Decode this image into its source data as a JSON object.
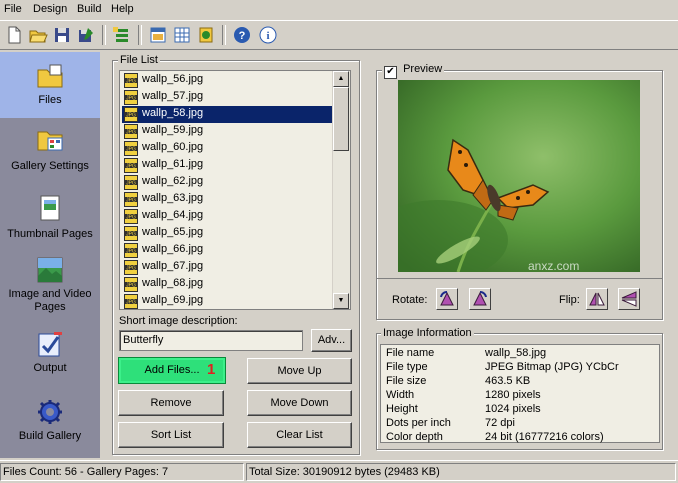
{
  "menu": [
    "File",
    "Design",
    "Build",
    "Help"
  ],
  "toolbar": {
    "icons": [
      "new-document-icon",
      "open-folder-icon",
      "save-icon",
      "save-as-icon",
      "add-files-icon",
      "html-page-icon",
      "table-layout-icon",
      "build-icon",
      "help-icon",
      "info-icon"
    ]
  },
  "nav": {
    "items": [
      {
        "label": "Files",
        "icon": "files-folder-icon"
      },
      {
        "label": "Gallery Settings",
        "icon": "gallery-settings-icon"
      },
      {
        "label": "Thumbnail Pages",
        "icon": "thumbnail-pages-icon"
      },
      {
        "label": "Image and Video Pages",
        "icon": "image-video-pages-icon"
      },
      {
        "label": "Output",
        "icon": "output-icon"
      },
      {
        "label": "Build Gallery",
        "icon": "build-gallery-icon"
      }
    ]
  },
  "file_list": {
    "title": "File List",
    "files": [
      "wallp_56.jpg",
      "wallp_57.jpg",
      "wallp_58.jpg",
      "wallp_59.jpg",
      "wallp_60.jpg",
      "wallp_61.jpg",
      "wallp_62.jpg",
      "wallp_63.jpg",
      "wallp_64.jpg",
      "wallp_65.jpg",
      "wallp_66.jpg",
      "wallp_67.jpg",
      "wallp_68.jpg",
      "wallp_69.jpg"
    ],
    "selected": "wallp_58.jpg",
    "icon_text": "JPG"
  },
  "description": {
    "label": "Short image description:",
    "value": "Butterfly",
    "adv_label": "Adv..."
  },
  "buttons": {
    "add_files": "Add Files...",
    "badge": "1",
    "move_up": "Move Up",
    "remove": "Remove",
    "move_down": "Move Down",
    "sort_list": "Sort List",
    "clear_list": "Clear List"
  },
  "preview": {
    "label": "Preview",
    "checked": true,
    "rotate_label": "Rotate:",
    "flip_label": "Flip:",
    "watermark": "anxz.com"
  },
  "image_info": {
    "title": "Image Information",
    "rows": [
      {
        "k": "File name",
        "v": "wallp_58.jpg"
      },
      {
        "k": "File type",
        "v": "JPEG Bitmap (JPG) YCbCr"
      },
      {
        "k": "File size",
        "v": "463.5 KB"
      },
      {
        "k": "Width",
        "v": "1280 pixels"
      },
      {
        "k": "Height",
        "v": "1024 pixels"
      },
      {
        "k": "Dots per inch",
        "v": "72 dpi"
      },
      {
        "k": "Color depth",
        "v": "24 bit (16777216 colors)"
      }
    ]
  },
  "status": {
    "left": "Files Count: 56 - Gallery Pages: 7",
    "right": "Total Size: 30190912 bytes (29483 KB)"
  },
  "colors": {
    "accent": "#0a246a",
    "nav_bg": "#8a8a9c",
    "nav_active": "#9fb4e8",
    "add_button": "#2ee07a",
    "badge": "#e02020"
  }
}
